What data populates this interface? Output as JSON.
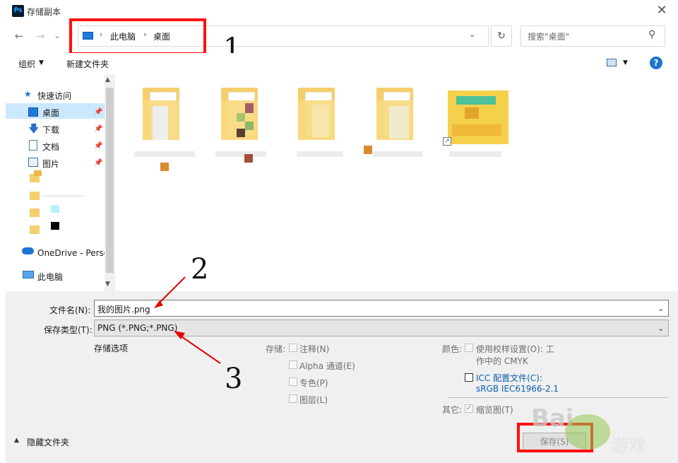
{
  "window": {
    "title": "存储副本",
    "app_icon": "Ps",
    "close": "✕"
  },
  "nav": {
    "back": "←",
    "forward": "→",
    "recent": "⌄",
    "up": "↑",
    "crumbs": [
      "此电脑",
      "桌面"
    ],
    "crumb_sep": "›",
    "refresh": "↻",
    "search_placeholder": "搜索\"桌面\""
  },
  "toolbar": {
    "organize": "组织",
    "new_folder": "新建文件夹",
    "help": "?"
  },
  "sidebar": {
    "items": [
      {
        "label": "快速访问",
        "icon": "star-icon"
      },
      {
        "label": "桌面",
        "icon": "desktop-icon",
        "pinned": true,
        "selected": true
      },
      {
        "label": "下载",
        "icon": "download-icon",
        "pinned": true
      },
      {
        "label": "文档",
        "icon": "document-icon",
        "pinned": true
      },
      {
        "label": "图片",
        "icon": "picture-icon",
        "pinned": true
      },
      {
        "label": "OneDrive - Perso",
        "icon": "cloud-icon"
      },
      {
        "label": "此电脑",
        "icon": "computer-icon"
      }
    ]
  },
  "form": {
    "filename_label": "文件名(N):",
    "filename_value": "我的图片.png",
    "filetype_label": "保存类型(T):",
    "filetype_value": "PNG (*.PNG;*.PNG)",
    "save_options": "存储选项",
    "storage_label": "存储:",
    "storage_opts": [
      "注释(N)",
      "Alpha 通道(E)",
      "专色(P)",
      "图层(L)"
    ],
    "color_label": "颜色:",
    "proof_line1": "使用校样设置(O):  工",
    "proof_line2": "作中的 CMYK",
    "icc_line1": "ICC 配置文件(C):",
    "icc_line2": "sRGB IEC61966-2.1",
    "other_label": "其它:",
    "thumbnail": "缩览图(T)",
    "hide_folders": "隐藏文件夹",
    "save_button": "保存(S)"
  },
  "annotations": [
    "1",
    "2",
    "3"
  ],
  "colors": {
    "annotation_red": "#ff0f0f",
    "selection": "#cce8ff",
    "link": "#0a5fb0",
    "help": "#1f73d2"
  }
}
